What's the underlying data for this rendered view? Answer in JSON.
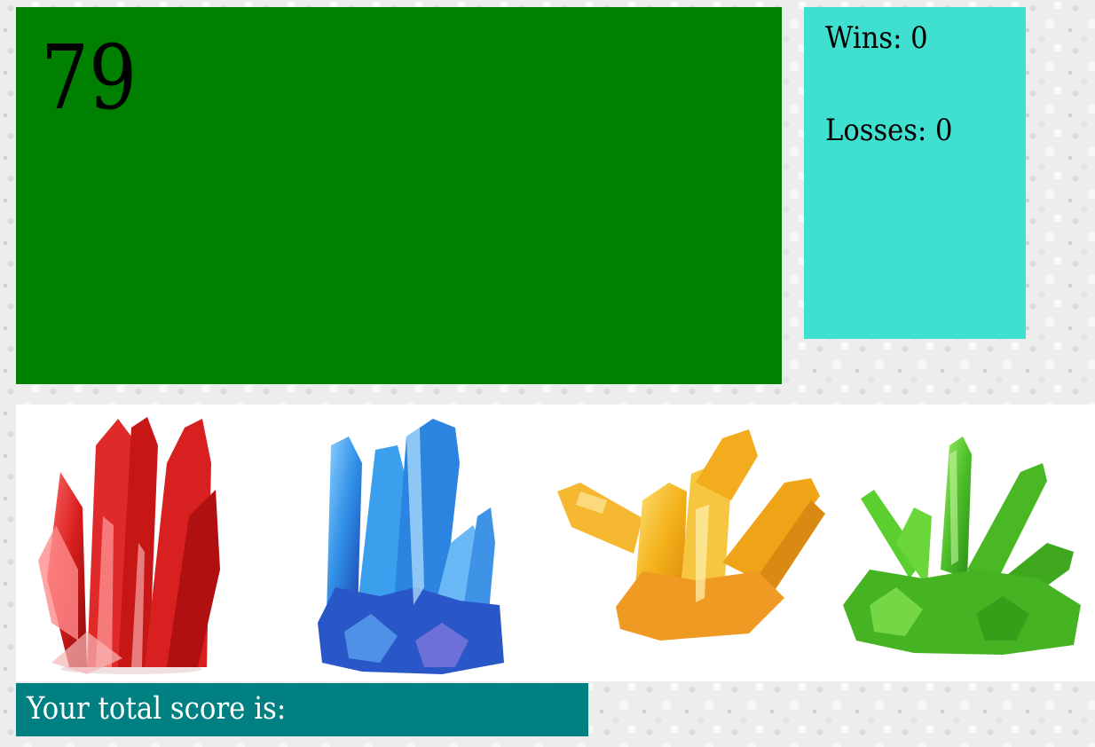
{
  "target": {
    "number": "79"
  },
  "stats": {
    "wins_text": "Wins: 0",
    "losses_text": "Losses: 0"
  },
  "crystals": [
    {
      "name": "red",
      "icon": "red-crystal-icon",
      "color": "#d81e1e"
    },
    {
      "name": "blue",
      "icon": "blue-crystal-icon",
      "color": "#2f8ee6"
    },
    {
      "name": "yellow",
      "icon": "yellow-crystal-icon",
      "color": "#f3b21a"
    },
    {
      "name": "green",
      "icon": "green-crystal-icon",
      "color": "#4cbf2a"
    }
  ],
  "score": {
    "label": "Your total score is:",
    "value": ""
  },
  "colors": {
    "target_bg": "#008000",
    "stats_bg": "#40e0d0",
    "score_bg": "#008080",
    "crystal_row_bg": "#ffffff"
  }
}
